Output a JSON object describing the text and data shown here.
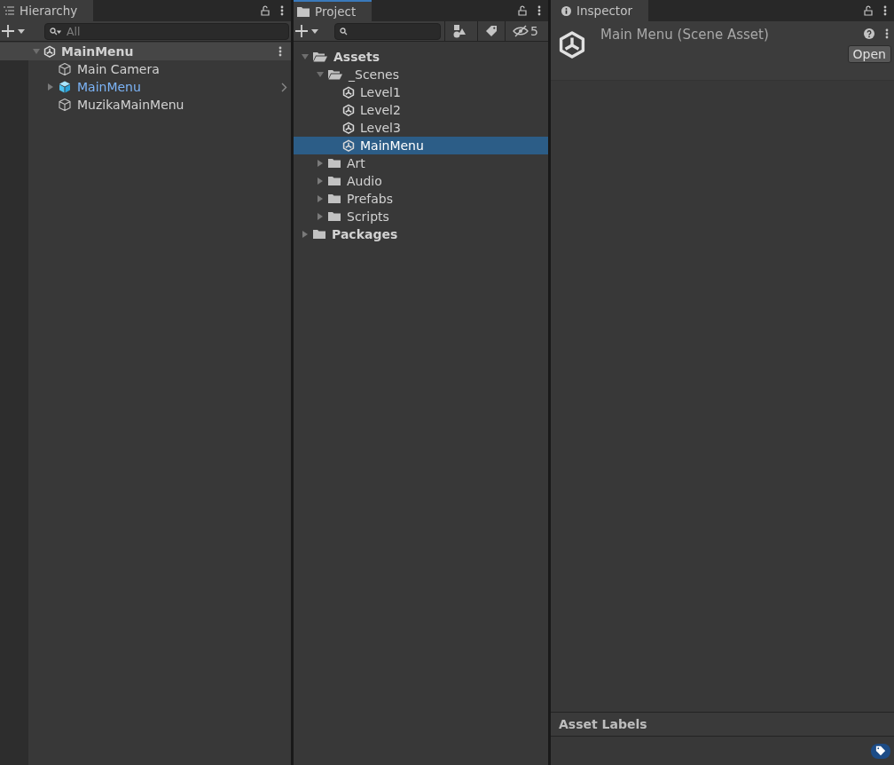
{
  "hierarchy": {
    "tab": {
      "label": "Hierarchy",
      "selected": true
    },
    "search": {
      "placeholder": "All"
    },
    "items": [
      {
        "kind": "scene",
        "label": "MainMenu",
        "expanded": true,
        "selected": false,
        "children": [
          {
            "kind": "gameobject",
            "label": "Main Camera",
            "selected": false
          },
          {
            "kind": "prefab",
            "label": "MainMenu",
            "expanded": false,
            "selected": false
          },
          {
            "kind": "gameobject",
            "label": "MuzikaMainMenu",
            "selected": false
          }
        ]
      }
    ]
  },
  "project": {
    "tab": {
      "label": "Project",
      "selected": true
    },
    "hidden_count": "5",
    "items": [
      {
        "kind": "folder",
        "label": "Assets",
        "expanded": true,
        "selected": false,
        "children": [
          {
            "kind": "folder",
            "label": "_Scenes",
            "expanded": true,
            "selected": false,
            "children": [
              {
                "kind": "scene",
                "label": "Level1",
                "selected": false
              },
              {
                "kind": "scene",
                "label": "Level2",
                "selected": false
              },
              {
                "kind": "scene",
                "label": "Level3",
                "selected": false
              },
              {
                "kind": "scene",
                "label": "MainMenu",
                "selected": true
              }
            ]
          },
          {
            "kind": "folder",
            "label": "Art",
            "expanded": false,
            "selected": false
          },
          {
            "kind": "folder",
            "label": "Audio",
            "expanded": false,
            "selected": false
          },
          {
            "kind": "folder",
            "label": "Prefabs",
            "expanded": false,
            "selected": false
          },
          {
            "kind": "folder",
            "label": "Scripts",
            "expanded": false,
            "selected": false
          }
        ]
      },
      {
        "kind": "folder",
        "label": "Packages",
        "expanded": false,
        "selected": false
      }
    ]
  },
  "inspector": {
    "tab": {
      "label": "Inspector",
      "selected": true
    },
    "title": "Main Menu (Scene Asset)",
    "open_button": "Open",
    "labels_header": "Asset Labels"
  }
}
